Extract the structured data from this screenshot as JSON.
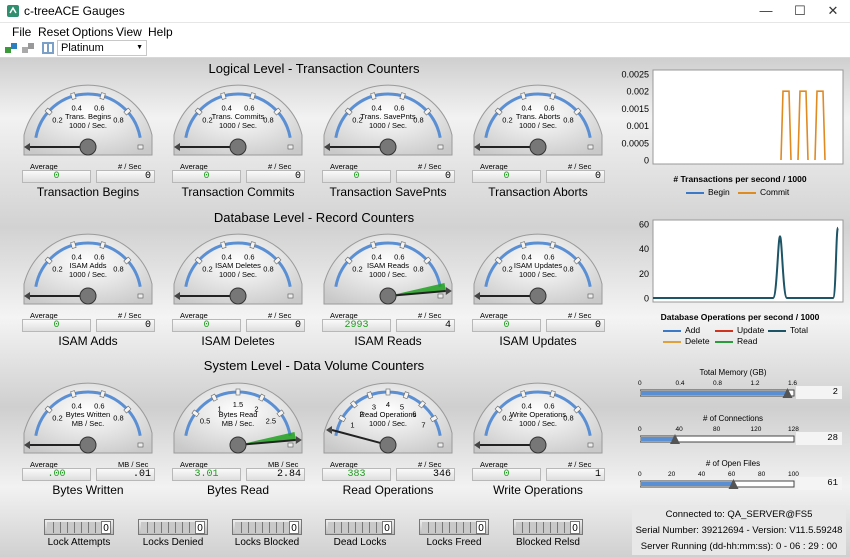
{
  "window": {
    "title": "c-treeACE Gauges"
  },
  "menu": [
    "File",
    "Reset",
    "Options",
    "View",
    "Help"
  ],
  "toolbar": {
    "theme": "Platinum"
  },
  "sections": {
    "logical": "Logical Level - Transaction Counters",
    "database": "Database Level - Record Counters",
    "system": "System Level - Data Volume Counters"
  },
  "common": {
    "average": "Average",
    "per_sec": "# / Sec"
  },
  "gauges": [
    {
      "title": "Trans. Begins",
      "unit": "1000 / Sec.",
      "label": "Transaction Begins",
      "ticks": [
        "0.2",
        "0.4",
        "0.6",
        "0.8"
      ],
      "average": "0",
      "rate": "0",
      "rate_label": "# / Sec"
    },
    {
      "title": "Trans. Commits",
      "unit": "1000 / Sec.",
      "label": "Transaction Commits",
      "ticks": [
        "0.2",
        "0.4",
        "0.6",
        "0.8"
      ],
      "average": "0",
      "rate": "0",
      "rate_label": "# / Sec"
    },
    {
      "title": "Trans. SavePnts",
      "unit": "1000 / Sec.",
      "label": "Transaction SavePnts",
      "ticks": [
        "0.2",
        "0.4",
        "0.6",
        "0.8"
      ],
      "average": "0",
      "rate": "0",
      "rate_label": "# / Sec"
    },
    {
      "title": "Trans. Aborts",
      "unit": "1000 / Sec.",
      "label": "Transaction Aborts",
      "ticks": [
        "0.2",
        "0.4",
        "0.6",
        "0.8"
      ],
      "average": "0",
      "rate": "0",
      "rate_label": "# / Sec"
    },
    {
      "title": "ISAM Adds",
      "unit": "1000 / Sec.",
      "label": "ISAM Adds",
      "ticks": [
        "0.2",
        "0.4",
        "0.6",
        "0.8"
      ],
      "average": "0",
      "rate": "0",
      "rate_label": "# / Sec"
    },
    {
      "title": "ISAM Deletes",
      "unit": "1000 / Sec.",
      "label": "ISAM Deletes",
      "ticks": [
        "0.2",
        "0.4",
        "0.6",
        "0.8"
      ],
      "average": "0",
      "rate": "0",
      "rate_label": "# / Sec"
    },
    {
      "title": "ISAM Reads",
      "unit": "1000 / Sec.",
      "label": "ISAM Reads",
      "ticks": [
        "0.2",
        "0.4",
        "0.6",
        "0.8"
      ],
      "average": "2993",
      "rate": "4",
      "rate_label": "# / Sec"
    },
    {
      "title": "ISAM Updates",
      "unit": "1000 / Sec.",
      "label": "ISAM Updates",
      "ticks": [
        "0.2",
        "0.4",
        "0.6",
        "0.8"
      ],
      "average": "0",
      "rate": "0",
      "rate_label": "# / Sec"
    },
    {
      "title": "Bytes Written",
      "unit": "MB / Sec.",
      "label": "Bytes Written",
      "ticks": [
        "0.2",
        "0.4",
        "0.6",
        "0.8"
      ],
      "average": ".00",
      "rate": ".01",
      "rate_label": "MB / Sec"
    },
    {
      "title": "Bytes Read",
      "unit": "MB / Sec.",
      "label": "Bytes Read",
      "ticks": [
        "0.5",
        "1",
        "1.5",
        "2",
        "2.5"
      ],
      "average": "3.01",
      "rate": "2.84",
      "rate_label": "MB / Sec"
    },
    {
      "title": "Read Operations",
      "unit": "1000 / Sec.",
      "label": "Read Operations",
      "ticks": [
        "1",
        "2",
        "3",
        "4",
        "5",
        "6",
        "7"
      ],
      "average": "383",
      "rate": "346",
      "rate_label": "# / Sec"
    },
    {
      "title": "Write Operations",
      "unit": "1000 / Sec.",
      "label": "Write Operations",
      "ticks": [
        "0.2",
        "0.4",
        "0.6",
        "0.8"
      ],
      "average": "0",
      "rate": "1",
      "rate_label": "# / Sec"
    }
  ],
  "chart_data": [
    {
      "type": "line",
      "title": "# Transactions per second / 1000",
      "yticks": [
        "0.0025",
        "0.002",
        "0.0015",
        "0.001",
        "0.0005",
        "0"
      ],
      "ylim": [
        0,
        0.0025
      ],
      "series": [
        {
          "name": "Begin",
          "color": "#3a78c9",
          "values": []
        },
        {
          "name": "Commit",
          "color": "#e08a22",
          "values": [
            0,
            0.002,
            0,
            0.002,
            0,
            0.002,
            0
          ]
        }
      ]
    },
    {
      "type": "line",
      "title": "Database Operations per second / 1000",
      "yticks": [
        "60",
        "40",
        "20",
        "0"
      ],
      "ylim": [
        0,
        60
      ],
      "series": [
        {
          "name": "Add",
          "color": "#3a78c9"
        },
        {
          "name": "Update",
          "color": "#d0331f"
        },
        {
          "name": "Total",
          "color": "#1d5466",
          "values": [
            0,
            50,
            0,
            57
          ]
        },
        {
          "name": "Delete",
          "color": "#e0a03a"
        },
        {
          "name": "Read",
          "color": "#2a9c3a"
        }
      ]
    }
  ],
  "sliders": [
    {
      "title": "Total Memory (GB)",
      "ticks": [
        "0",
        "0.4",
        "0.8",
        "1.2",
        "1.6"
      ],
      "value": "2",
      "level": 0.97
    },
    {
      "title": "# of Connections",
      "ticks": [
        "0",
        "40",
        "80",
        "120",
        "128"
      ],
      "value": "28",
      "level": 0.22
    },
    {
      "title": "# of Open Files",
      "ticks": [
        "0",
        "20",
        "40",
        "60",
        "80",
        "100"
      ],
      "value": "61",
      "level": 0.61
    }
  ],
  "locks": [
    {
      "label": "Lock Attempts",
      "value": "0"
    },
    {
      "label": "Locks Denied",
      "value": "0"
    },
    {
      "label": "Locks Blocked",
      "value": "0"
    },
    {
      "label": "Dead Locks",
      "value": "0"
    },
    {
      "label": "Locks Freed",
      "value": "0"
    },
    {
      "label": "Blocked Relsd",
      "value": "0"
    }
  ],
  "status": {
    "connected": "Connected to:  QA_SERVER@FS5",
    "serial": "Serial Number: 39212694 - Version: V11.5.59248",
    "running": "Server Running (dd-hh:mm:ss): 0 - 06 : 29 : 00"
  }
}
